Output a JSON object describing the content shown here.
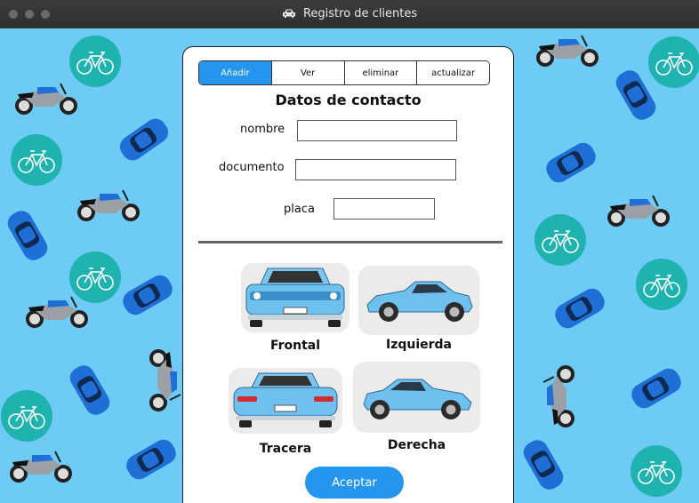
{
  "window": {
    "title": "Registro de clientes",
    "title_icon": "car-icon"
  },
  "tabs": [
    {
      "label": "Añadir",
      "active": true
    },
    {
      "label": "Ver",
      "active": false
    },
    {
      "label": "eliminar",
      "active": false
    },
    {
      "label": "actualizar",
      "active": false
    }
  ],
  "form": {
    "title": "Datos de contacto",
    "fields": [
      {
        "label": "nombre",
        "value": ""
      },
      {
        "label": "documento",
        "value": ""
      },
      {
        "label": "placa",
        "value": ""
      }
    ]
  },
  "views": [
    {
      "label": "Frontal"
    },
    {
      "label": "Izquierda"
    },
    {
      "label": "Tracera"
    },
    {
      "label": "Derecha"
    }
  ],
  "actions": {
    "accept_label": "Aceptar"
  },
  "colors": {
    "background": "#6ecbf5",
    "accent": "#2496f0",
    "bike_circle": "#1fb3b0",
    "car_blue": "#1f6fd6"
  }
}
